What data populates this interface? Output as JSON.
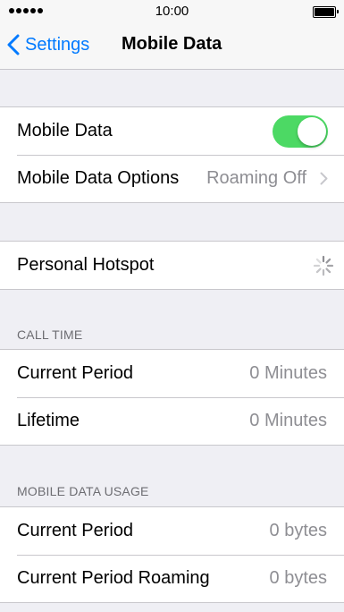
{
  "status_bar": {
    "time": "10:00",
    "signal_dots": 5,
    "battery_level": 1.0
  },
  "nav": {
    "back_label": "Settings",
    "title": "Mobile Data"
  },
  "group1": {
    "mobile_data_label": "Mobile Data",
    "mobile_data_on": true,
    "options_label": "Mobile Data Options",
    "options_value": "Roaming Off"
  },
  "group2": {
    "hotspot_label": "Personal Hotspot"
  },
  "call_time": {
    "header": "CALL TIME",
    "current_period_label": "Current Period",
    "current_period_value": "0 Minutes",
    "lifetime_label": "Lifetime",
    "lifetime_value": "0 Minutes"
  },
  "data_usage": {
    "header": "MOBILE DATA USAGE",
    "current_period_label": "Current Period",
    "current_period_value": "0 bytes",
    "roaming_label": "Current Period Roaming",
    "roaming_value": "0 bytes"
  },
  "colors": {
    "accent": "#007aff",
    "toggle_on": "#4cd964",
    "secondary_text": "#8e8e93",
    "background": "#efeff4"
  }
}
